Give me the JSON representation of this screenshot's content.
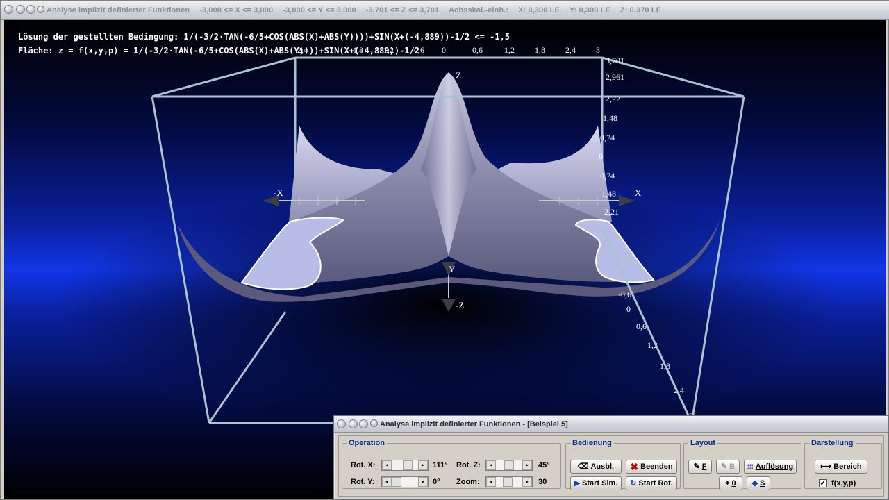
{
  "window": {
    "title_segments": [
      "Analyse implizit definierter Funktionen",
      "-3,000 <= X <= 3,000",
      "-3,000 <= Y <= 3,000",
      "-3,701 <= Z <= 3,701",
      "Achsskal.-einh.:",
      "X: 0,300 LE",
      "Y: 0,300 LE",
      "Z: 0,370 LE"
    ]
  },
  "viewport": {
    "condition_text": "Lösung der gestellten Bedingung: 1/(-3/2·TAN(-6/5+COS(ABS(X)+ABS(Y))))+SIN(X+(-4,889))-1/2 <= -1,5",
    "surface_text": "Fläche: z = f(x,y,p) = 1/(-3/2·TAN(-6/5+COS(ABS(X)+ABS(Y))))+SIN(X+(-4,889))-1/2",
    "axis_names": {
      "x_neg": "-X",
      "x_pos": "X",
      "z_pos": "Z",
      "y_pos": "Y",
      "z_neg": "-Z"
    },
    "top_ticks": [
      "-2,4",
      "-1,8",
      "-1,2",
      "-0,6",
      "0",
      "0,6",
      "1,2",
      "1,8",
      "2,4",
      "3"
    ],
    "z_ticks": [
      "3,701",
      "2,961",
      "2,22",
      "1,48",
      "0,74",
      "0",
      "0,74",
      "1,48",
      "2,21"
    ],
    "y_ticks": [
      "-0,6",
      "0",
      "0,6",
      "1,2",
      "1,8",
      "2,4",
      "3"
    ]
  },
  "control_window": {
    "title": "Analyse implizit definierter Funktionen - [Beispiel 5]",
    "operation": {
      "legend": "Operation",
      "rot_x_label": "Rot. X:",
      "rot_x_value": "111°",
      "rot_y_label": "Rot. Y:",
      "rot_y_value": "0°",
      "rot_z_label": "Rot. Z:",
      "rot_z_value": "45°",
      "zoom_label": "Zoom:",
      "zoom_value": "30"
    },
    "bedienung": {
      "legend": "Bedienung",
      "ausbl_label": "Ausbl.",
      "beenden_label": "Beenden",
      "start_sim_label": "Start Sim.",
      "start_rot_label": "Start Rot."
    },
    "layout": {
      "legend": "Layout",
      "f_label": "F",
      "b_label": "B",
      "aufloesung_label": "Auflösung",
      "o_label": "0",
      "s_label": "S"
    },
    "darstellung": {
      "legend": "Darstellung",
      "bereich_label": "Bereich",
      "fxyp_label": "f(x,y,p)",
      "fxyp_checked": true
    }
  },
  "colors": {
    "surface_fill": "#8f8fb3",
    "highlight_fill": "#b7bde6",
    "box_stroke": "#a9c3cf",
    "legend_text": "#0a2a8a",
    "close_icon": "#c00000",
    "play_icon": "#1a3cc8"
  }
}
